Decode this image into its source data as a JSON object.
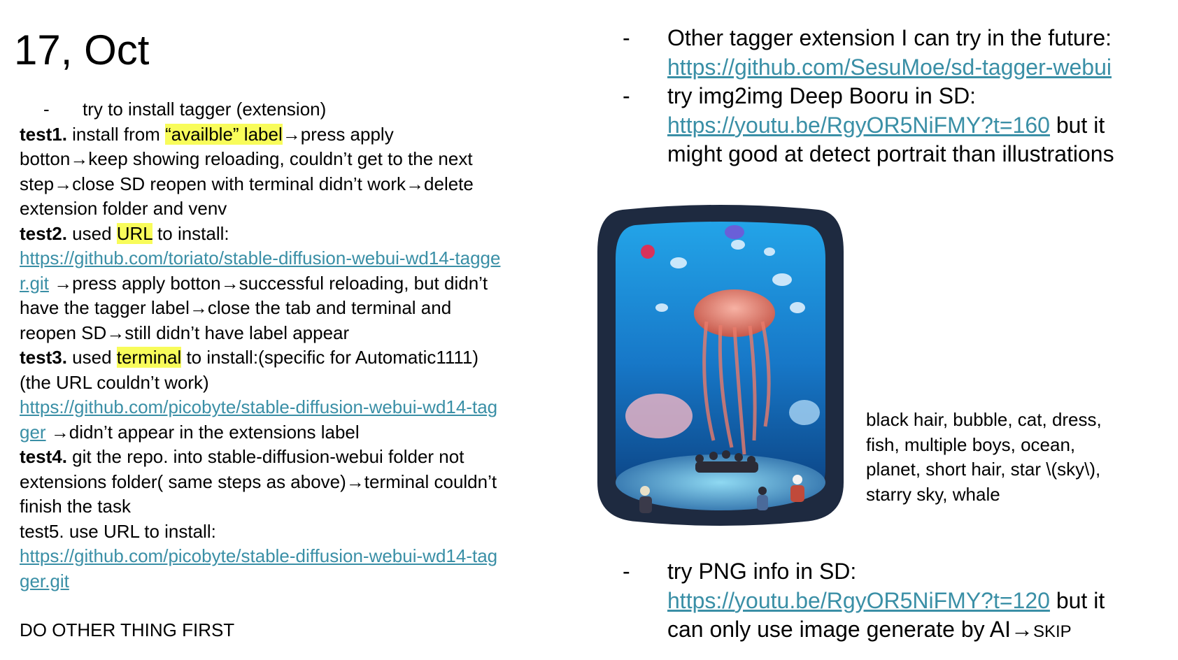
{
  "title": "17, Oct",
  "left": {
    "bullet": "-",
    "bullet_text": "try to install tagger (extension)",
    "test1": {
      "label": "test1.",
      "pre": " install from ",
      "highlight": "“availble” label",
      "post": "→press apply",
      "lines": [
        "botton→keep showing reloading, couldn’t get to the next",
        "step→close SD reopen with terminal didn’t work→delete",
        "extension folder and venv"
      ]
    },
    "test2": {
      "label": "test2.",
      "pre": " used ",
      "highlight": "URL",
      "post": " to install:",
      "link_line1": "https://github.com/toriato/stable-diffusion-webui-wd14-tagge",
      "link_line2": "r.git",
      "after_link": " →press apply botton→successful reloading, but didn’t",
      "lines": [
        "have the tagger label→close the tab and terminal and",
        "reopen SD→still didn’t have label appear"
      ]
    },
    "test3": {
      "label": "test3.",
      "pre": " used ",
      "highlight": "terminal",
      "post": " to install:(specific for Automatic1111)",
      "line2": "(the URL couldn’t work)",
      "link_line1": "https://github.com/picobyte/stable-diffusion-webui-wd14-tag",
      "link_line2": "ger",
      "after_link": " →didn’t appear in the extensions label"
    },
    "test4": {
      "label": "test4.",
      "text": " git the repo. into stable-diffusion-webui folder not",
      "lines": [
        "extensions folder( same steps as above)→terminal couldn’t",
        "finish the task"
      ]
    },
    "test5": {
      "text": "test5. use URL to install:",
      "link_line1": "https://github.com/picobyte/stable-diffusion-webui-wd14-tag",
      "link_line2": "ger.git"
    },
    "footer": "DO OTHER THING FIRST"
  },
  "right_top": {
    "bullet": "-",
    "item1": {
      "text": "Other tagger extension I can try in the future:",
      "link": "https://github.com/SesuMoe/sd-tagger-webui"
    },
    "item2": {
      "text": "try img2img Deep Booru in SD:",
      "link": "https://youtu.be/RgyOR5NiFMY?t=160",
      "after_link": " but it",
      "line3": "might good at detect portrait than illustrations"
    }
  },
  "tags": {
    "lines": [
      "black hair, bubble, cat, dress,",
      "fish, multiple boys, ocean,",
      "planet, short hair, star \\(sky\\),",
      "starry sky, whale"
    ]
  },
  "right_bottom": {
    "bullet": "-",
    "text": "try PNG info in SD:",
    "link": "https://youtu.be/RgyOR5NiFMY?t=120",
    "after_link": " but it",
    "line3": "can only use image generate by AI→",
    "skip": "SKIP"
  },
  "colors": {
    "link": "#3a8fa6",
    "highlight": "#f8fc5a",
    "frame": "#1e2a40",
    "water": "#1c8fd8"
  }
}
